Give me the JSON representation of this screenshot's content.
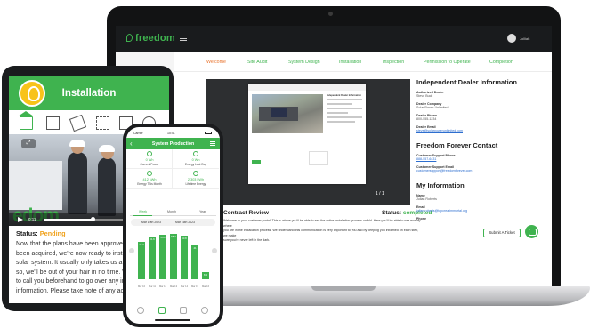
{
  "laptop": {
    "brand": "freedom",
    "user_name": "Jolliah",
    "nav_tabs": [
      {
        "label": "Welcome",
        "active": true
      },
      {
        "label": "Site Audit"
      },
      {
        "label": "System Design"
      },
      {
        "label": "Installation"
      },
      {
        "label": "Inspection"
      },
      {
        "label": "Permission to Operate"
      },
      {
        "label": "Completion"
      }
    ],
    "contract": {
      "title": "Contract Review",
      "status_label": "Status:",
      "status_value": "completed",
      "body_lines": [
        "Welcome to your customer portal! This is where you'll be able to see the entire installation process unfold. Here you'll be able to see exactly where",
        "you are in the installation process. We understand this communication is very important to you and by keeping you informed on each step, we make",
        "sure you're never left in the dark."
      ]
    },
    "dealer": {
      "heading": "Independent Dealer Information",
      "fields": [
        {
          "label": "Authorized Dealer",
          "value": "Steve Buck"
        },
        {
          "label": "Dealer Company",
          "value": "Solar Power Unlimited"
        },
        {
          "label": "Dealer Phone",
          "value": "800-555-1234"
        },
        {
          "label": "Dealer Email",
          "value": "steve@solarpowerunlimited.com",
          "link": true
        }
      ]
    },
    "freedom_contact": {
      "heading": "Freedom Forever Contact",
      "fields": [
        {
          "label": "Customer Support Phone",
          "value": "888-557-6431",
          "link": true
        },
        {
          "label": "Customer Support Email",
          "value": "customersupport@freedomforever.com",
          "link": true
        }
      ]
    },
    "my_info": {
      "heading": "My Information",
      "fields": [
        {
          "label": "Name",
          "value": "Julian Roberts"
        },
        {
          "label": "Email",
          "value": "julian.roberts@topcreatimmortal.org",
          "link": true
        },
        {
          "label": "Phone",
          "value": ""
        }
      ],
      "ticket_label": "Submit A Ticket"
    },
    "doc_title": "Independent Dealer Information",
    "viewer_pages": "1 / 1"
  },
  "tablet": {
    "title": "Installation",
    "video_time": "0:11",
    "status_label": "Status:",
    "status_value": "Pending",
    "body_lines": [
      "Now that the plans have been approved a",
      "been acquired, we're now ready to install",
      "solar system. It usually only takes us a d",
      "so, we'll be out of your hair in no time. W",
      "to call you beforehand to go over any imp",
      "information. Please take note of any acc"
    ]
  },
  "phone": {
    "status_carrier": "Carrier",
    "status_time": "10:41",
    "title": "System Production",
    "metrics": [
      {
        "value": "0 Wh",
        "label": "Current Power"
      },
      {
        "value": "0 Wh",
        "label": "Energy Last Day"
      },
      {
        "value": "412 kWh",
        "label": "Energy This Month"
      },
      {
        "value": "2,303 kWh",
        "label": "Lifetime Energy"
      }
    ],
    "period_tabs": [
      {
        "label": "Week",
        "active": true
      },
      {
        "label": "Month"
      },
      {
        "label": "Year"
      }
    ],
    "range_start": "Mar 10th 2023",
    "range_end": "Mar 16th 2023",
    "chart_data": {
      "type": "bar",
      "categories": [
        "Mar 10",
        "Mar 11",
        "Mar 12",
        "Mar 13",
        "Mar 14",
        "Mar 15",
        "Mar 16"
      ],
      "values": [
        45.3,
        51.9,
        55.1,
        55.7,
        53.8,
        41.0,
        8.3
      ],
      "ylim": [
        0,
        60
      ]
    }
  }
}
